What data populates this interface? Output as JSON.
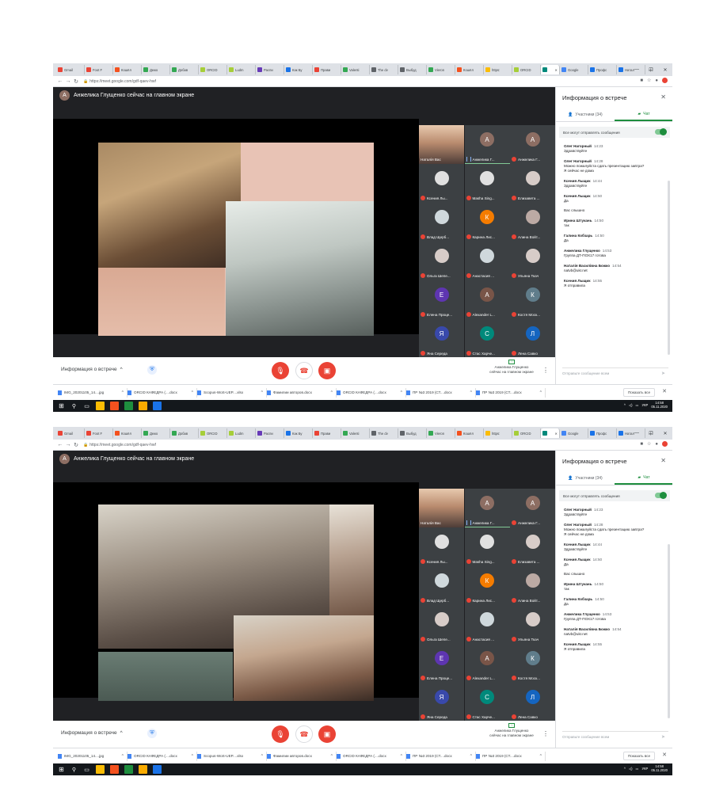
{
  "tabs": [
    {
      "label": "Gmail",
      "color": "#ea4335"
    },
    {
      "label": "Foot F",
      "color": "#ea4335"
    },
    {
      "label": "Кошёл",
      "color": "#f4511e"
    },
    {
      "label": "Дежо",
      "color": "#34a853"
    },
    {
      "label": "Добав",
      "color": "#34a853"
    },
    {
      "label": "ORCID",
      "color": "#a6ce39"
    },
    {
      "label": "Ludm",
      "color": "#a6ce39"
    },
    {
      "label": "Распи",
      "color": "#673ab7"
    },
    {
      "label": "Как Бу",
      "color": "#1a73e8"
    },
    {
      "label": "Прави",
      "color": "#ea4335"
    },
    {
      "label": "Valenti",
      "color": "#34a853"
    },
    {
      "label": "The dv",
      "color": "#5f6368"
    },
    {
      "label": "Выбуд",
      "color": "#5f6368"
    },
    {
      "label": "Vieron",
      "color": "#34a853"
    },
    {
      "label": "Кошёл",
      "color": "#f4511e"
    },
    {
      "label": "https:",
      "color": "#fbbc04"
    },
    {
      "label": "ORCID",
      "color": "#a6ce39"
    },
    {
      "label": "",
      "color": "#00897b",
      "active": true
    },
    {
      "label": "Google",
      "color": "#4285f4"
    },
    {
      "label": "Профс",
      "color": "#1a73e8"
    },
    {
      "label": "Натал",
      "color": "#1a73e8"
    }
  ],
  "url": "https://meet.google.com/gdf-qaev-hwf",
  "presenter_banner": "Анжелика Глущенко сейчас на главном экране",
  "presenter_initial": "А",
  "tiles": [
    {
      "name": "Наталія Вас",
      "initial": "",
      "color": "#5f6368",
      "video": true,
      "status": "none"
    },
    {
      "name": "Анжелика Г...",
      "initial": "А",
      "color": "#8d6e63",
      "status": "speaking"
    },
    {
      "name": "Анжелика Г...",
      "initial": "А",
      "color": "#8d6e63",
      "status": "muted"
    },
    {
      "name": "Ксения Лы...",
      "initial": "",
      "color": "#e0e0e0",
      "status": "muted"
    },
    {
      "name": "Masha Sing...",
      "initial": "",
      "color": "#e0e0e0",
      "status": "muted"
    },
    {
      "name": "Елизавета ...",
      "initial": "",
      "color": "#d7ccc8",
      "status": "muted"
    },
    {
      "name": "Влад Щерб...",
      "initial": "",
      "color": "#cfd8dc",
      "status": "muted"
    },
    {
      "name": "Карина Лис...",
      "initial": "К",
      "color": "#f57c00",
      "status": "muted"
    },
    {
      "name": "Алина Войт...",
      "initial": "",
      "color": "#bcaaa4",
      "status": "muted"
    },
    {
      "name": "Ольга Шепе...",
      "initial": "",
      "color": "#d7ccc8",
      "status": "muted"
    },
    {
      "name": "Анастасия ...",
      "initial": "",
      "color": "#cfd8dc",
      "status": "muted"
    },
    {
      "name": "Ульяна Ткач",
      "initial": "",
      "color": "#d7ccc8",
      "status": "muted"
    },
    {
      "name": "Елена Проце...",
      "initial": "Е",
      "color": "#5e35b1",
      "status": "muted"
    },
    {
      "name": "Alexander L...",
      "initial": "А",
      "color": "#795548",
      "status": "muted"
    },
    {
      "name": "Костя Моск...",
      "initial": "К",
      "color": "#607d8b",
      "status": "muted"
    },
    {
      "name": "Яна Середа",
      "initial": "Я",
      "color": "#3949ab",
      "status": "muted"
    },
    {
      "name": "Стас Харче...",
      "initial": "С",
      "color": "#00897b",
      "status": "muted"
    },
    {
      "name": "Лена Савко",
      "initial": "Л",
      "color": "#1565c0",
      "status": "muted"
    }
  ],
  "bottom": {
    "meeting_info": "Информация о встрече",
    "presenting_line1": "Анжелика Глущенко",
    "presenting_line2": "сейчас на главном экране"
  },
  "panel": {
    "title": "Информация о встрече",
    "participants_tab": "Участники (34)",
    "chat_tab": "Чат",
    "allow_messages": "Все могут отправлять сообщения",
    "input_placeholder": "Отправьте сообщение всем"
  },
  "messages": [
    {
      "sender": "Олег Нагорный",
      "time": "14:23",
      "lines": [
        "Здравствуйте"
      ]
    },
    {
      "sender": "Олег Нагорный",
      "time": "14:28",
      "lines": [
        "Можно пожалуйста сдать презентацию завтра?",
        "Я сейчас не дома"
      ]
    },
    {
      "sender": "Ксения Лыщик",
      "time": "14:44",
      "lines": [
        "Здравствуйте"
      ]
    },
    {
      "sender": "Ксения Лыщик",
      "time": "14:50",
      "lines": [
        "Да",
        "",
        "Вас слышно"
      ]
    },
    {
      "sender": "Ирина Штукань",
      "time": "14:50",
      "lines": [
        "так"
      ]
    },
    {
      "sender": "Галина Кобзарь",
      "time": "14:50",
      "lines": [
        "Да"
      ]
    },
    {
      "sender": "Анжелика Глущенко",
      "time": "14:53",
      "lines": [
        "Группа ДТ-ПОХ17 готова"
      ]
    },
    {
      "sender": "Наталія Василівна Божко",
      "time": "14:54",
      "lines": [
        "natvb@ukr.net"
      ]
    },
    {
      "sender": "Ксения Лыщик",
      "time": "14:55",
      "lines": [
        "Я отправила"
      ]
    }
  ],
  "downloads": [
    "IMG_20201105_14....jpg",
    "ORCID КАФЕДРА (....docx",
    "Scopus-WoS-UEP....xlsx",
    "Фамилии авторов.docx",
    "ORCID КАФЕДРА (....docx",
    "ПР №3 2019 (СТ....docx",
    "ПР №3 2019 (СТ....docx"
  ],
  "show_all": "Показать все",
  "taskbar": {
    "lang": "УКР",
    "time": "14:58",
    "date": "05.11.2020"
  }
}
